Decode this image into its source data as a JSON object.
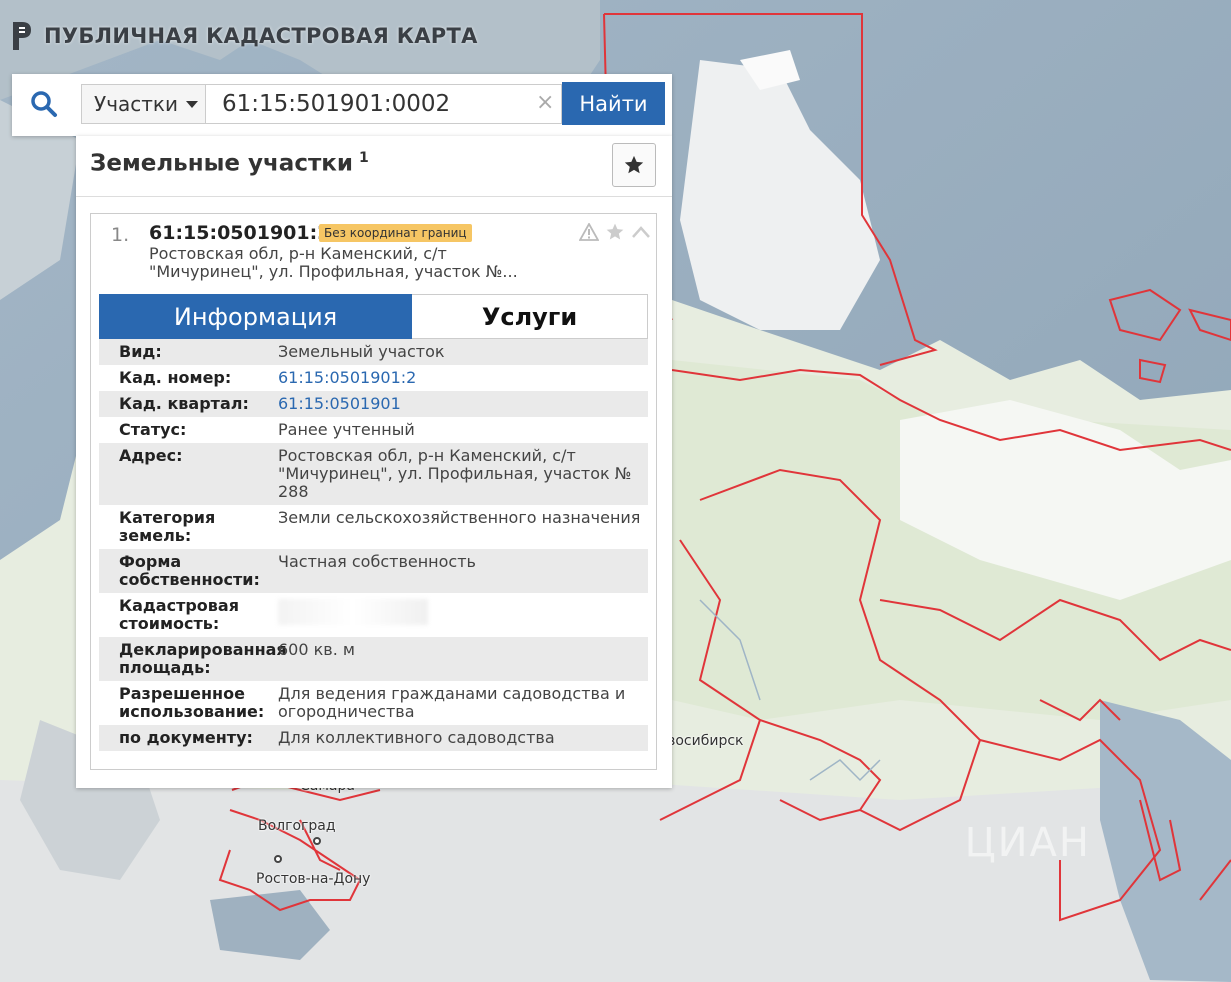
{
  "app": {
    "title": "ПУБЛИЧНАЯ КАДАСТРОВАЯ КАРТА"
  },
  "search": {
    "type_selected": "Участки",
    "query": "61:15:501901:0002",
    "clear_symbol": "×",
    "find_label": "Найти"
  },
  "results": {
    "title": "Земельные участки",
    "count": "1",
    "item": {
      "index": "1.",
      "number": "61:15:0501901:2",
      "badge": "Без координат границ",
      "address_short": "Ростовская обл, р-н Каменский, с/т \"Мичуринец\", ул. Профильная, участок №..."
    },
    "tabs": {
      "info": "Информация",
      "services": "Услуги"
    },
    "rows": [
      {
        "label": "Вид:",
        "value": "Земельный участок",
        "link": false
      },
      {
        "label": "Кад. номер:",
        "value": "61:15:0501901:2",
        "link": true
      },
      {
        "label": "Кад. квартал:",
        "value": "61:15:0501901",
        "link": true
      },
      {
        "label": "Статус:",
        "value": "Ранее учтенный",
        "link": false
      },
      {
        "label": "Адрес:",
        "value": "Ростовская обл, р-н Каменский, с/т \"Мичуринец\", ул. Профильная, участок № 288",
        "link": false
      },
      {
        "label": "Категория земель:",
        "value": "Земли сельскохозяйственного назначения",
        "link": false
      },
      {
        "label": "Форма собственности:",
        "value": "Частная собственность",
        "link": false
      },
      {
        "label": "Кадастровая стоимость:",
        "value": "",
        "link": false,
        "blurred": true
      },
      {
        "label": "Декларированная площадь:",
        "value": "600 кв. м",
        "link": false
      },
      {
        "label": "Разрешенное использование:",
        "value": "Для ведения гражданами садоводства и огородничества",
        "link": false
      },
      {
        "label": "по документу:",
        "value": "Для коллективного садоводства",
        "link": false
      }
    ]
  },
  "map": {
    "labels": [
      "Самара",
      "Волгоград",
      "Ростов-на-Дону",
      "Новосибирск"
    ],
    "watermark": "ЦИАН"
  },
  "colors": {
    "accent": "#2a68b0",
    "badge": "#f6c664",
    "boundary": "#e0353a",
    "land": "#e9efe3",
    "sea": "#a9bccb"
  }
}
